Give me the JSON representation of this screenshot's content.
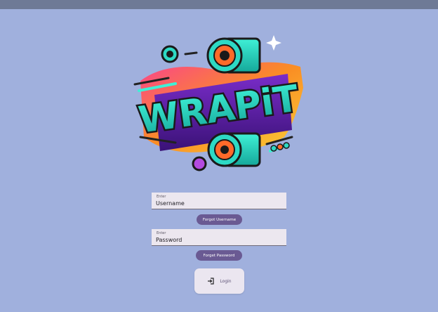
{
  "logo": {
    "text": "WRAPiT"
  },
  "username": {
    "label": "Enter",
    "placeholder": "Username"
  },
  "forgot_username": {
    "label": "Forgot Username"
  },
  "password": {
    "label": "Enter",
    "placeholder": "Password"
  },
  "forgot_password": {
    "label": "Forget Password"
  },
  "login": {
    "label": "Login",
    "icon": "login-icon"
  },
  "colors": {
    "background": "#a0b0dd",
    "pill": "#6a5a93",
    "field": "#ece7ef",
    "topbar": "#6e7a96"
  }
}
